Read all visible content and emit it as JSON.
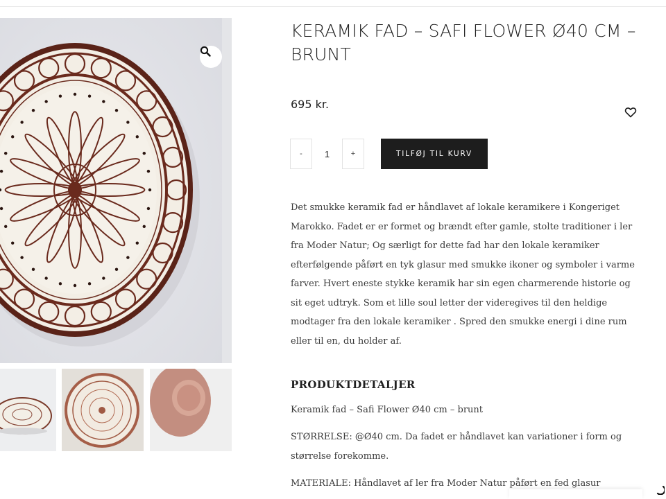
{
  "product": {
    "title": "KERAMIK FAD – SAFI FLOWER Ø40 CM – BRUNT",
    "price": "695 kr.",
    "quantity": "1",
    "qty_minus_label": "-",
    "qty_plus_label": "+",
    "add_to_cart_label": "TILFØJ TIL KURV",
    "description": "Det smukke keramik fad er håndlavet af lokale keramikere i Kongeriget Marokko. Fadet er er formet og brændt efter gamle, stolte traditioner i ler fra Moder Natur; Og særligt for dette fad har den lokale keramiker efterfølgende påført en tyk glasur med smukke ikoner og symboler i varme farver. Hvert eneste stykke keramik har sin egen charmerende historie og sit eget udtryk. Som et lille soul letter der videregives til den heldige modtager fra den lokale keramiker . Spred den smukke energi i dine rum eller til en, du holder af."
  },
  "details": {
    "heading": "PRODUKTDETALJER",
    "line_1": "Keramik fad – Safi Flower Ø40 cm – brunt",
    "line_2": "STØRRELSE: @Ø40 cm. Da fadet er håndlavet kan variationer i form og størrelse forekomme.",
    "line_3": "MATERIALE: Håndlavet af ler fra Moder Natur påført en fed glasur"
  },
  "icons": {
    "zoom": "magnifier-icon",
    "wishlist": "heart-icon"
  },
  "colors": {
    "plate_brown": "#6a2a1d",
    "plate_cream": "#f4efe6",
    "button_dark": "#1d1d1d"
  }
}
